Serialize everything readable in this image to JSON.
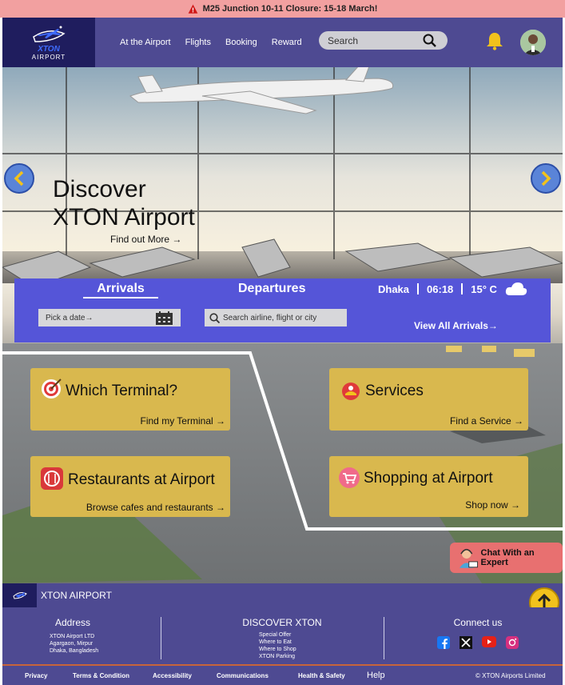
{
  "alert": {
    "text": "M25 Junction 10-11 Closure: 15-18 March!"
  },
  "header": {
    "brand": "XTON",
    "brand_sub": "AIRPORT",
    "nav": [
      "At the Airport",
      "Flights",
      "Booking",
      "Reward"
    ],
    "search_placeholder": "Search"
  },
  "hero": {
    "title_line1": "Discover",
    "title_line2": "XTON Airport",
    "cta": "Find out More →"
  },
  "flights_panel": {
    "tab_arrivals": "Arrivals",
    "tab_departures": "Departures",
    "city": "Dhaka",
    "time": "06:18",
    "temp": "15° C",
    "date_placeholder": "Pick a date→",
    "flight_placeholder": "Search airline, flight or city",
    "view_all": "View All Arrivals→"
  },
  "cards": {
    "terminal": {
      "title": "Which Terminal?",
      "link": "Find my Terminal →"
    },
    "services": {
      "title": "Services",
      "link": "Find a Service →"
    },
    "restaurants": {
      "title": "Restaurants at Airport",
      "link": "Browse cafes and restaurants →"
    },
    "shopping": {
      "title": "Shopping at Airport",
      "link": "Shop now →"
    }
  },
  "chat": {
    "label": "Chat With an Expert"
  },
  "footer": {
    "name": "XTON AIRPORT",
    "address_title": "Address",
    "address_lines": [
      "XTON Airport LTD",
      "Agargaon, Mirpur",
      "Dhaka, Bangladesh"
    ],
    "discover_title": "DISCOVER XTON",
    "discover_links": [
      "Special Offer",
      "Where to Eat",
      "Where to Shop",
      "XTON Parking"
    ],
    "connect_title": "Connect us",
    "legal": [
      "Privacy",
      "Terms & Condition",
      "Accessibility",
      "Communications",
      "Health & Safety",
      "Help"
    ],
    "copyright": "© XTON Airports Limited"
  },
  "colors": {
    "header": "#4e4a92",
    "panel": "#5555d8",
    "card": "#d9b84e",
    "alert": "#f2a0a0",
    "chat": "#e87070"
  }
}
